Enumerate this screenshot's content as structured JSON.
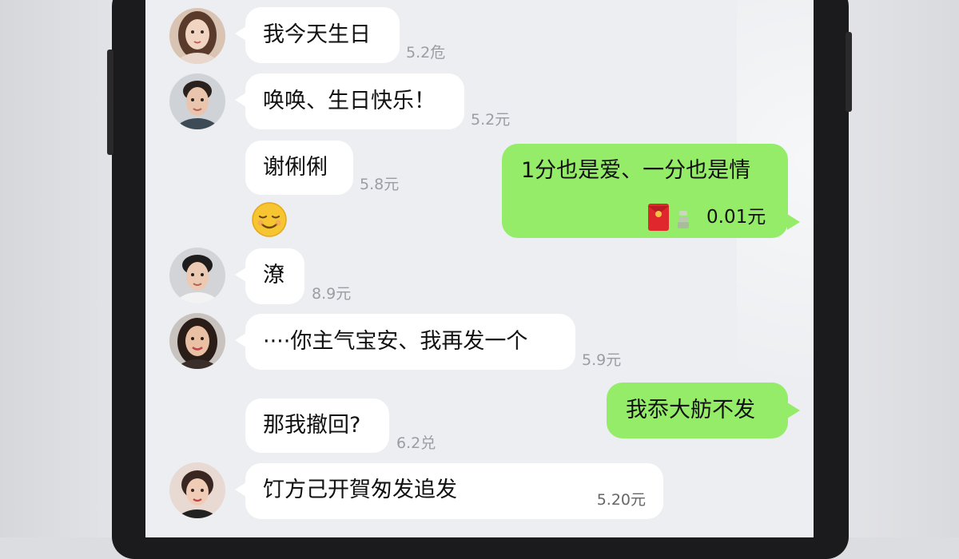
{
  "chat": {
    "messages": [
      {
        "sender": "woman-1",
        "side": "left",
        "text": "我今天生日",
        "amount": "5.2危"
      },
      {
        "sender": "man-1",
        "side": "left",
        "text": "唤唤、生日快乐！",
        "amount": "5.2元"
      },
      {
        "sender": "man-1",
        "side": "left",
        "text": "谢俐俐",
        "amount": "5.8元",
        "emoji": "relieved-face"
      },
      {
        "sender": "self",
        "side": "right",
        "text": "1分也是爱、一分也是情",
        "red_packet_amount": "0.01元"
      },
      {
        "sender": "man-2",
        "side": "left",
        "text": "潦",
        "amount": "8.9元"
      },
      {
        "sender": "woman-2",
        "side": "left",
        "text": "····你主气宝安、我再发一个",
        "amount": "5.9元"
      },
      {
        "sender": "self",
        "side": "right",
        "text": "我忝大舫不发"
      },
      {
        "sender": "man-2",
        "side": "left",
        "text": "那我撤回?",
        "amount": "6.2兑"
      },
      {
        "sender": "woman-3",
        "side": "left",
        "text": "饤方己开賀匆发追发",
        "amount": "5.20元"
      }
    ]
  },
  "colors": {
    "chat_background": "#eceef1",
    "incoming_bubble": "#ffffff",
    "outgoing_bubble": "#95ec69",
    "red_packet": "#e0272d",
    "amount_text": "#9a9da3"
  },
  "icons": {
    "red_packet": "red-envelope-icon",
    "emoji": "relieved-face-emoji"
  }
}
